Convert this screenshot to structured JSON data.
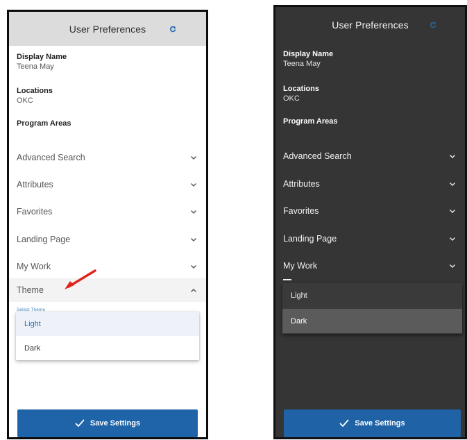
{
  "panels": [
    {
      "theme": "light",
      "header": {
        "title": "User Preferences",
        "refresh_icon": "refresh-icon"
      },
      "display_name": {
        "label": "Display Name",
        "value": "Teena May"
      },
      "locations": {
        "label": "Locations",
        "value": "OKC"
      },
      "program_areas": {
        "label": "Program Areas"
      },
      "accordion": [
        {
          "label": "Advanced Search",
          "state": "collapsed"
        },
        {
          "label": "Attributes",
          "state": "collapsed"
        },
        {
          "label": "Favorites",
          "state": "collapsed"
        },
        {
          "label": "Landing Page",
          "state": "collapsed"
        },
        {
          "label": "My Work",
          "state": "collapsed"
        },
        {
          "label": "Theme",
          "state": "expanded"
        }
      ],
      "select_theme_label": "Select Theme",
      "theme_options": [
        {
          "label": "Light",
          "selected": true
        },
        {
          "label": "Dark",
          "selected": false
        }
      ],
      "save_button": {
        "label": "Save Settings",
        "icon": "check-icon"
      },
      "colors": {
        "header_bg": "#dcdcdc",
        "accent": "#1f64a8",
        "selected_option_text": "#2d6db3",
        "annotation_arrow": "#e0241b"
      }
    },
    {
      "theme": "dark",
      "header": {
        "title": "User Preferences",
        "refresh_icon": "refresh-icon"
      },
      "display_name": {
        "label": "Display Name",
        "value": "Teena May"
      },
      "locations": {
        "label": "Locations",
        "value": "OKC"
      },
      "program_areas": {
        "label": "Program Areas"
      },
      "accordion": [
        {
          "label": "Advanced Search",
          "state": "collapsed"
        },
        {
          "label": "Attributes",
          "state": "collapsed"
        },
        {
          "label": "Favorites",
          "state": "collapsed"
        },
        {
          "label": "Landing Page",
          "state": "collapsed"
        },
        {
          "label": "My Work",
          "state": "collapsed"
        }
      ],
      "theme_options": [
        {
          "label": "Light",
          "selected": false
        },
        {
          "label": "Dark",
          "selected": true
        }
      ],
      "save_button": {
        "label": "Save Settings",
        "icon": "check-icon"
      },
      "colors": {
        "panel_bg": "#353535",
        "accent": "#1f63a6",
        "selected_option_bg": "#5b5b5b"
      }
    }
  ]
}
